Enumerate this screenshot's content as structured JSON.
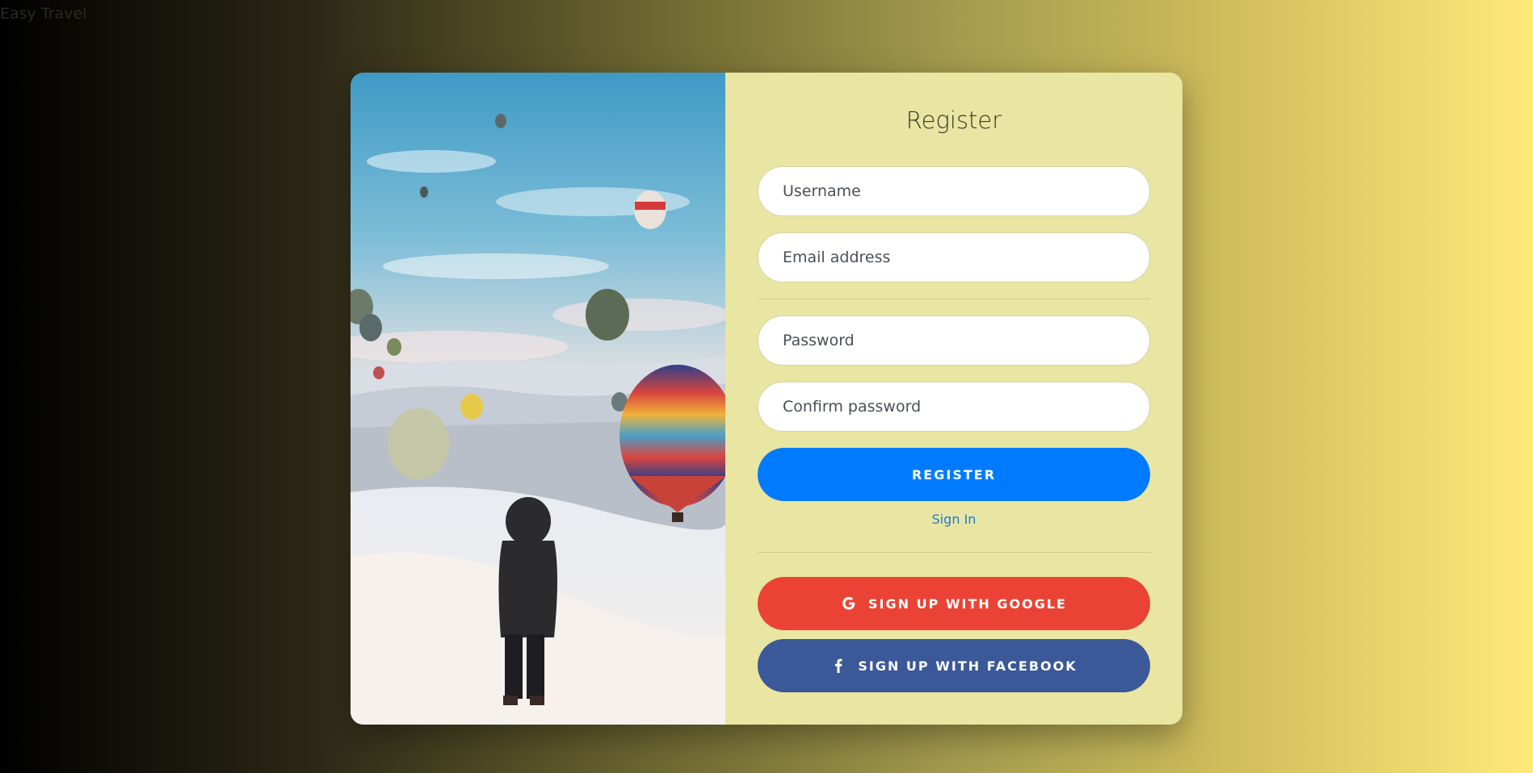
{
  "app": {
    "brand": "Easy Travel"
  },
  "form": {
    "title": "Register",
    "username_placeholder": "Username",
    "email_placeholder": "Email address",
    "password_placeholder": "Password",
    "confirm_password_placeholder": "Confirm password",
    "register_label": "REGISTER",
    "signin_label": "Sign In",
    "google_label": "SIGN UP WITH GOOGLE",
    "facebook_label": "SIGN UP WITH FACEBOOK"
  },
  "icons": {
    "google": "google-icon",
    "facebook": "facebook-icon"
  },
  "colors": {
    "register_button": "#007bff",
    "google_button": "#ea4335",
    "facebook_button": "#3b5998",
    "panel_background": "#e9e5a2",
    "link": "#1f7ad6"
  }
}
